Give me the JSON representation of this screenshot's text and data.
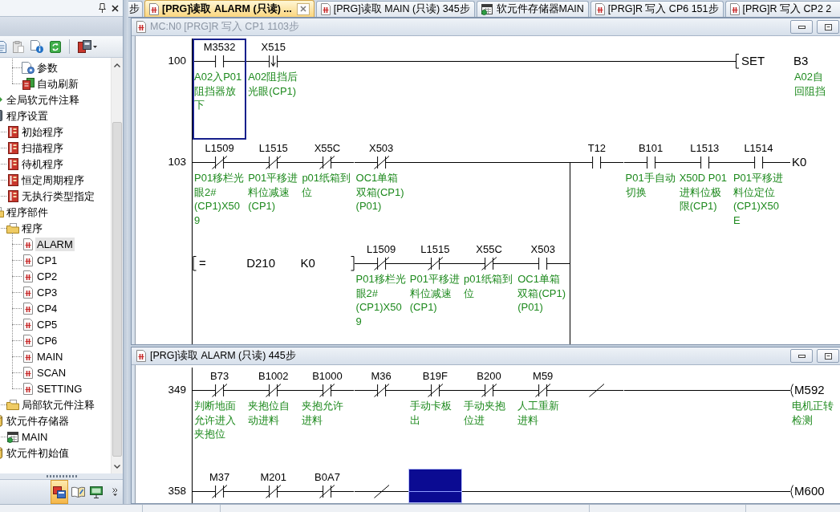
{
  "side_panel": {
    "tree": {
      "items": [
        {
          "children": [
            {
              "children": [
                {
                  "label": "参数",
                  "kind": "parameter",
                  "selected": false
                },
                {
                  "label": "自动刷新",
                  "kind": "refresh",
                  "selected": false
                }
              ]
            }
          ]
        },
        {
          "label": "全局软元件注释",
          "kind": "comment",
          "selected": false
        },
        {
          "label": "程序设置",
          "kind": "settings",
          "selected": false,
          "children": [
            {
              "label": "初始程序",
              "kind": "book",
              "selected": false
            },
            {
              "label": "扫描程序",
              "kind": "book",
              "selected": false
            },
            {
              "label": "待机程序",
              "kind": "book",
              "selected": false
            },
            {
              "label": "恒定周期程序",
              "kind": "book",
              "selected": false
            },
            {
              "label": "无执行类型指定",
              "kind": "book",
              "selected": false
            }
          ]
        },
        {
          "label": "程序部件",
          "kind": "folder",
          "selected": false,
          "children": [
            {
              "label": "程序",
              "kind": "folder",
              "selected": false,
              "children": [
                {
                  "label": "ALARM",
                  "kind": "program",
                  "selected": true
                },
                {
                  "label": "CP1",
                  "kind": "program",
                  "selected": false
                },
                {
                  "label": "CP2",
                  "kind": "program",
                  "selected": false
                },
                {
                  "label": "CP3",
                  "kind": "program",
                  "selected": false
                },
                {
                  "label": "CP4",
                  "kind": "program",
                  "selected": false
                },
                {
                  "label": "CP5",
                  "kind": "program",
                  "selected": false
                },
                {
                  "label": "CP6",
                  "kind": "program",
                  "selected": false
                },
                {
                  "label": "MAIN",
                  "kind": "program",
                  "selected": false
                },
                {
                  "label": "SCAN",
                  "kind": "program",
                  "selected": false
                },
                {
                  "label": "SETTING",
                  "kind": "program",
                  "selected": false
                }
              ]
            },
            {
              "label": "局部软元件注释",
              "kind": "folder",
              "selected": false
            }
          ]
        },
        {
          "label": "软元件存储器",
          "kind": "memory",
          "selected": false,
          "children": [
            {
              "label": "MAIN",
              "kind": "calendar",
              "selected": false
            }
          ]
        },
        {
          "label": "软元件初始值",
          "kind": "memory",
          "selected": false
        }
      ]
    },
    "switcher": [
      {
        "kind": "navigation",
        "selected": true
      },
      {
        "kind": "element",
        "selected": false
      },
      {
        "kind": "connection",
        "selected": false
      }
    ]
  },
  "tabs": [
    {
      "label": "步",
      "kind": "fragment",
      "selected": false
    },
    {
      "label": "[PRG]读取 ALARM (只读) ...",
      "kind": "program",
      "selected": true
    },
    {
      "label": "[PRG]读取 MAIN (只读) 345步",
      "kind": "program",
      "selected": false
    },
    {
      "label": "软元件存储器MAIN",
      "kind": "memory",
      "selected": false
    },
    {
      "label": "[PRG]R 写入 CP6 151步",
      "kind": "program",
      "selected": false
    },
    {
      "label": "[PRG]R 写入 CP2 2",
      "kind": "program",
      "selected": false
    }
  ],
  "windows": [
    {
      "title": "MC:N0 [PRG]R 写入 CP1 1103步",
      "active": false,
      "rungs": [
        {
          "step": "100",
          "rows": [
            {
              "cells": [
                {
                  "kind": "no",
                  "device": "M3532",
                  "comment": "A02入P01阻挡器放下",
                  "selected": true
                },
                {
                  "kind": "falling",
                  "device": "X515",
                  "comment": "A02阻挡后光眼(CP1)",
                  "selected": false
                },
                {
                  "kind": "wire",
                  "selected": false
                },
                {
                  "kind": "wire",
                  "selected": false
                },
                {
                  "kind": "wire",
                  "selected": false
                },
                {
                  "kind": "wire",
                  "selected": false
                },
                {
                  "kind": "wire",
                  "selected": false
                },
                {
                  "kind": "wire",
                  "selected": false
                },
                {
                  "kind": "wire",
                  "selected": false
                },
                {
                  "kind": "wire",
                  "selected": false
                },
                {
                  "kind": "set",
                  "instruction": "SET",
                  "device": "B3",
                  "comment": [
                    "A02自",
                    "回阻挡"
                  ],
                  "selected": false
                },
                ""
              ]
            }
          ]
        },
        {
          "step": "103",
          "rows": [
            {
              "cells": [
                {
                  "kind": "nc",
                  "device": "L1509",
                  "comment": "P01移栏光眼2#(CP1)X509",
                  "selected": false
                },
                {
                  "kind": "nc",
                  "device": "L1515",
                  "comment": "P01平移进料位减速(CP1)",
                  "selected": false
                },
                {
                  "kind": "nc",
                  "device": "X55C",
                  "comment": "p01纸箱到位",
                  "selected": false
                },
                {
                  "kind": "nc",
                  "device": "X503",
                  "comment": "OC1单箱双箱(CP1)(P01)",
                  "selected": false
                },
                {
                  "kind": "wire",
                  "selected": false
                },
                {
                  "kind": "wire",
                  "selected": false
                },
                {
                  "kind": "wire",
                  "selected": false
                },
                {
                  "kind": "no",
                  "device": "T12",
                  "selected": false
                },
                {
                  "kind": "no",
                  "device": "B101",
                  "comment": "P01手自动切换",
                  "selected": false
                },
                {
                  "kind": "no",
                  "device": "L1513",
                  "comment": "X50D P01进料位极限(CP1)",
                  "selected": false
                },
                {
                  "kind": "no",
                  "device": "L1514",
                  "comment": "P01平移进料位定位(CP1)X50E",
                  "selected": false
                },
                {
                  "kind": "constant",
                  "text": "K0",
                  "selected": false
                }
              ]
            },
            {
              "continues_below": true,
              "cells": [
                {
                  "kind": "compare",
                  "operator": "=",
                  "operands": [
                    "D210",
                    "K0"
                  ],
                  "selected": false
                },
                "",
                "",
                {
                  "kind": "nc",
                  "device": "L1509",
                  "comment": "P01移栏光眼2#(CP1)X509",
                  "selected": false
                },
                {
                  "kind": "nc",
                  "device": "L1515",
                  "comment": "P01平移进料位减速(CP1)",
                  "selected": false
                },
                {
                  "kind": "nc",
                  "device": "X55C",
                  "comment": "p01纸箱到位",
                  "selected": false
                },
                {
                  "kind": "no",
                  "device": "X503",
                  "comment": "OC1单箱双箱(CP1)(P01)",
                  "selected": false
                }
              ]
            }
          ]
        }
      ]
    },
    {
      "title": "[PRG]读取 ALARM (只读) 445步",
      "active": true,
      "rungs": [
        {
          "step": "349",
          "rows": [
            {
              "cells": [
                {
                  "kind": "nc",
                  "device": "B73",
                  "comment": "判断地面允许进入夹抱位",
                  "selected": false
                },
                {
                  "kind": "nc",
                  "device": "B1002",
                  "comment": "夹抱位自动进料",
                  "selected": false
                },
                {
                  "kind": "nc",
                  "device": "B1000",
                  "comment": "夹抱允许进料",
                  "selected": false
                },
                {
                  "kind": "nc",
                  "device": "M36",
                  "selected": false
                },
                {
                  "kind": "nc",
                  "device": "B19F",
                  "comment": "手动卡板出",
                  "selected": false
                },
                {
                  "kind": "nc",
                  "device": "B200",
                  "comment": "手动夹抱位进",
                  "selected": false
                },
                {
                  "kind": "nc",
                  "device": "M59",
                  "comment": "人工重新进料",
                  "selected": false
                },
                {
                  "kind": "inv",
                  "selected": false
                },
                {
                  "kind": "wire",
                  "selected": false
                },
                {
                  "kind": "wire",
                  "selected": false
                },
                {
                  "kind": "wire",
                  "selected": false
                },
                {
                  "kind": "coil",
                  "device": "M592",
                  "comment": "电机正转检测",
                  "selected": false
                }
              ]
            }
          ]
        },
        {
          "step": "358",
          "rows": [
            {
              "cells": [
                {
                  "kind": "nc",
                  "device": "M37",
                  "selected": false
                },
                {
                  "kind": "nc",
                  "device": "M201",
                  "selected": false
                },
                {
                  "kind": "nc",
                  "device": "B0A7",
                  "selected": false
                },
                {
                  "kind": "inv",
                  "selected": false
                },
                {
                  "kind": "wire",
                  "selected": true
                },
                {
                  "kind": "wire",
                  "selected": false
                },
                {
                  "kind": "wire",
                  "selected": false
                },
                {
                  "kind": "wire",
                  "selected": false
                },
                {
                  "kind": "wire",
                  "selected": false
                },
                {
                  "kind": "wire",
                  "selected": false
                },
                {
                  "kind": "wire",
                  "selected": false
                },
                {
                  "kind": "coil",
                  "device": "M600",
                  "selected": false
                }
              ]
            }
          ]
        }
      ]
    }
  ]
}
